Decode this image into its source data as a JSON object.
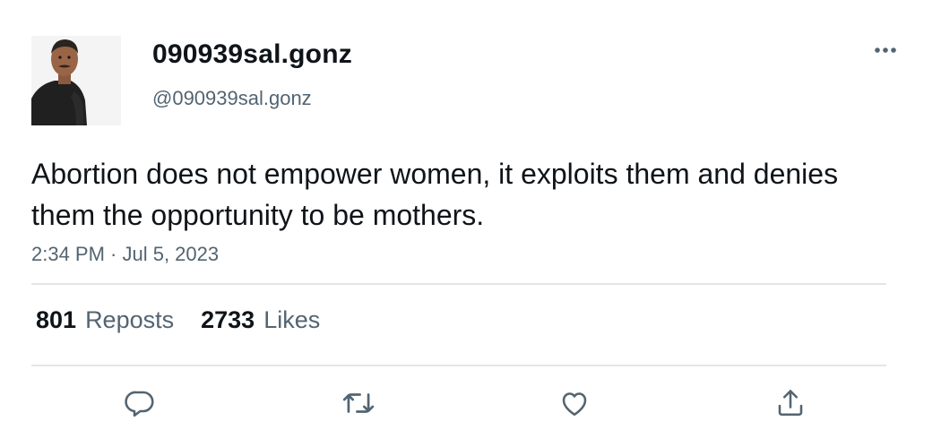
{
  "user": {
    "display_name": "090939sal.gonz",
    "handle": "@090939sal.gonz"
  },
  "tweet": {
    "text": "Abortion does not empower women, it exploits them and denies them the opportunity to be mothers.",
    "timestamp": "2:34 PM · Jul 5, 2023"
  },
  "stats": {
    "reposts_count": "801",
    "reposts_label": "Reposts",
    "likes_count": "2733",
    "likes_label": "Likes"
  },
  "icons": {
    "more": "more-dots-icon",
    "reply": "reply-icon",
    "repost": "repost-icon",
    "like": "heart-icon",
    "share": "share-icon"
  },
  "colors": {
    "text_primary": "#0f1419",
    "text_secondary": "#536471",
    "divider": "#e1e5e8"
  }
}
